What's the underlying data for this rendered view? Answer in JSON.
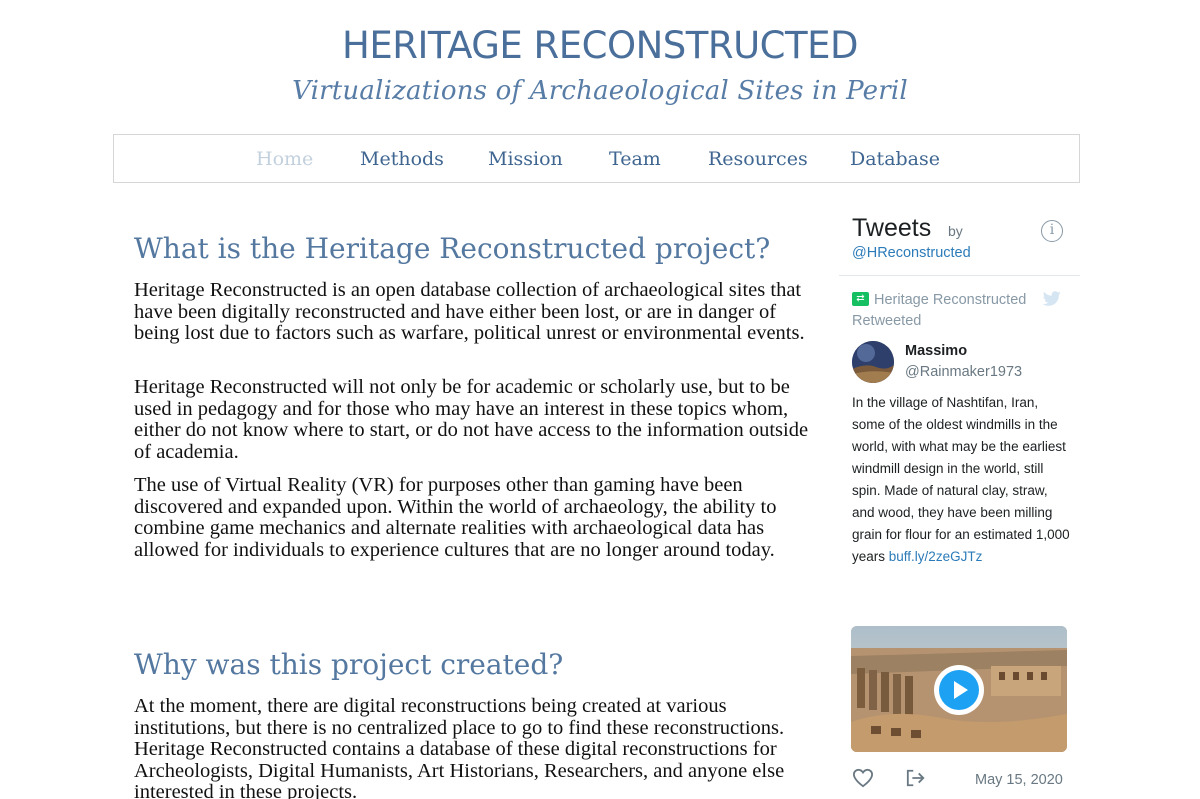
{
  "header": {
    "title": "HERITAGE RECONSTRUCTED",
    "subtitle": "Virtualizations of Archaeological Sites in Peril"
  },
  "nav": {
    "items": [
      {
        "label": "Home",
        "active": true
      },
      {
        "label": "Methods",
        "active": false
      },
      {
        "label": "Mission",
        "active": false
      },
      {
        "label": "Team",
        "active": false
      },
      {
        "label": "Resources",
        "active": false
      },
      {
        "label": "Database",
        "active": false
      }
    ]
  },
  "main": {
    "section1": {
      "heading": "What is the Heritage Reconstructed project?",
      "paragraphs": [
        "Heritage Reconstructed is an open database collection of archaeological sites that have been digitally reconstructed and have either been lost, or are in danger of being lost due to factors such as warfare, political unrest or environmental events.",
        "Heritage Reconstructed will not only be for academic or scholarly use, but to be used in pedagogy and for those who may have an interest in these topics whom, either do not know where to start, or do not have access to the information outside of academia.",
        "The use of Virtual Reality (VR) for purposes other than gaming have been discovered and expanded upon. Within the world of archaeology, the ability to combine game mechanics and alternate realities with archaeological data has allowed for individuals to experience cultures that are no longer around today."
      ]
    },
    "section2": {
      "heading": "Why was this project created?",
      "paragraphs": [
        "At the moment, there are digital reconstructions being created at various institutions, but there is no centralized place to go to find these reconstructions. Heritage Reconstructed contains a database of these digital reconstructions for Archeologists, Digital Humanists, Art Historians, Researchers, and anyone else interested in these projects."
      ]
    }
  },
  "twitter": {
    "title": "Tweets",
    "by": "by",
    "handle": "@HReconstructed",
    "retweet_text": "Heritage Reconstructed Retweeted",
    "tweet": {
      "name": "Massimo",
      "username": "@Rainmaker1973",
      "text": "In the village of Nashtifan, Iran, some of the oldest windmills in the world, with what may be the earliest windmill design in the world, still spin. Made of natural clay, straw, and wood, they have been milling grain for flour for an estimated 1,000 years",
      "link": "buff.ly/2zeGJTz",
      "date": "May 15, 2020"
    },
    "colors": {
      "accent": "#1da1f2",
      "link": "#2b7bb9",
      "retweet": "#17bf63"
    },
    "icons": [
      "retweet-icon",
      "twitter-bird-icon",
      "info-icon",
      "play-icon",
      "heart-icon",
      "share-icon"
    ]
  },
  "colors": {
    "title": "#4a6f9a",
    "heading": "#54789f",
    "nav": "#3f6691",
    "nav_active": "#c3d0de"
  }
}
